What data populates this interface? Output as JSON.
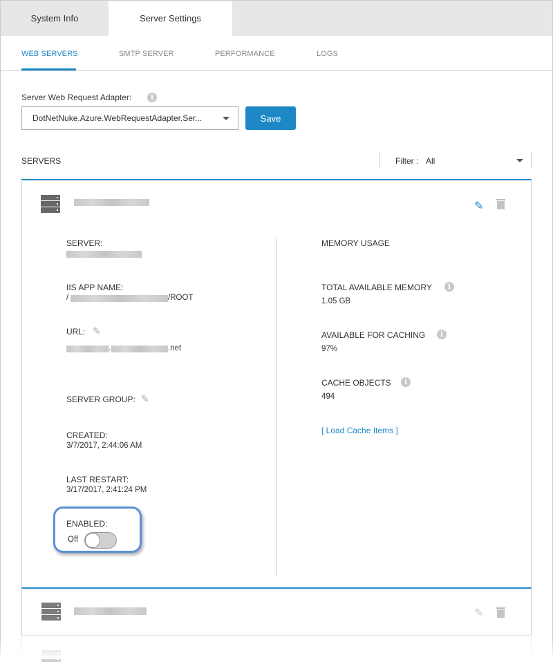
{
  "tabs": [
    {
      "label": "System Info",
      "active": false
    },
    {
      "label": "Server Settings",
      "active": true
    }
  ],
  "subtabs": [
    {
      "label": "WEB SERVERS",
      "active": true
    },
    {
      "label": "SMTP SERVER"
    },
    {
      "label": "PERFORMANCE"
    },
    {
      "label": "LOGS"
    }
  ],
  "adapter": {
    "label": "Server Web Request Adapter:",
    "value": "DotNetNuke.Azure.WebRequestAdapter.Ser...",
    "save_label": "Save"
  },
  "servers": {
    "title": "SERVERS",
    "filter_label": "Filter :",
    "filter_value": "All"
  },
  "server_card": {
    "server_label": "SERVER:",
    "iis_label": "IIS APP NAME:",
    "iis_prefix": "/",
    "iis_suffix": "/ROOT",
    "url_label": "URL:",
    "url_dot": ".",
    "url_suffix": ".net",
    "group_label": "SERVER GROUP:",
    "created_label": "CREATED:",
    "created_value": "3/7/2017, 2:44:06 AM",
    "restart_label": "LAST RESTART:",
    "restart_value": "3/17/2017, 2:41:24 PM",
    "enabled_label": "ENABLED:",
    "enabled_state": "Off",
    "memory_title": "MEMORY USAGE",
    "total_label": "TOTAL AVAILABLE MEMORY",
    "total_value": "1.05 GB",
    "caching_label": "AVAILABLE FOR CACHING",
    "caching_value": "97%",
    "objects_label": "CACHE OBJECTS",
    "objects_value": "494",
    "load_link": "[ Load Cache Items ]"
  },
  "colors": {
    "accent": "#1e88c7",
    "highlight": "#5a8fd6"
  }
}
